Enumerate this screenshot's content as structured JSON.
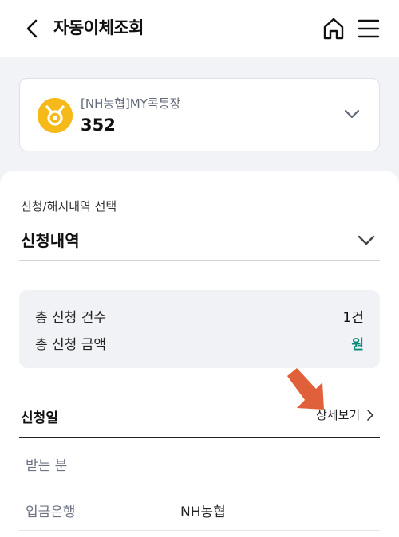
{
  "header": {
    "title": "자동이체조회",
    "back_icon": "chevron-left-icon",
    "home_icon": "home-icon",
    "menu_icon": "hamburger-menu-icon"
  },
  "account": {
    "name": "[NH농협]MY콕통장",
    "number": "352",
    "logo_icon": "nh-bank-logo-icon",
    "logo_color": "#f5b919",
    "dropdown_icon": "chevron-down-icon"
  },
  "filter": {
    "label": "신청/해지내역 선택",
    "selected": "신청내역",
    "chevron_icon": "chevron-down-icon"
  },
  "summary": {
    "count_label": "총 신청 건수",
    "count_value": "1건",
    "amount_label": "총 신청 금액",
    "amount_value": "원",
    "amount_color": "#0d8a7a"
  },
  "list": {
    "date_header": "신청일",
    "detail_link": "상세보기",
    "rows": [
      {
        "label": "받는 분",
        "value": ""
      },
      {
        "label": "입금은행",
        "value": "NH농협"
      }
    ]
  },
  "annotation": {
    "arrow_icon": "red-arrow-pointer-icon",
    "arrow_color": "#e0603a"
  }
}
